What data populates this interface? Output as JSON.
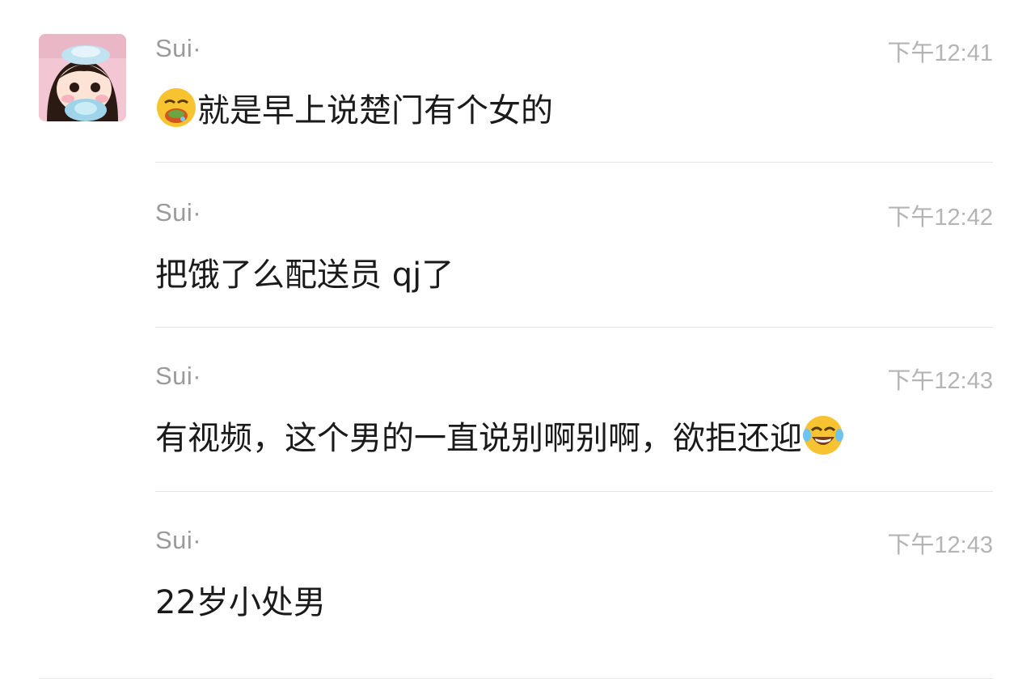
{
  "messages": [
    {
      "sender": "Sui·",
      "time": "下午12:41",
      "text": "就是早上说楚门有个女的",
      "emoji_before": "drooling-face-emoji"
    },
    {
      "sender": "Sui·",
      "time": "下午12:42",
      "text": "把饿了么配送员 qj了"
    },
    {
      "sender": "Sui·",
      "time": "下午12:43",
      "text": "有视频，这个男的一直说别啊别啊，欲拒还迎",
      "emoji_after": "tears-of-joy-emoji"
    },
    {
      "sender": "Sui·",
      "time": "下午12:43",
      "text": "22岁小处男"
    }
  ],
  "colors": {
    "sender": "#9a9a9a",
    "time": "#b4b4b4",
    "text": "#1a1a1a",
    "divider": "#e4e4e4"
  },
  "avatar_icon": "cartoon-girl-avatar"
}
